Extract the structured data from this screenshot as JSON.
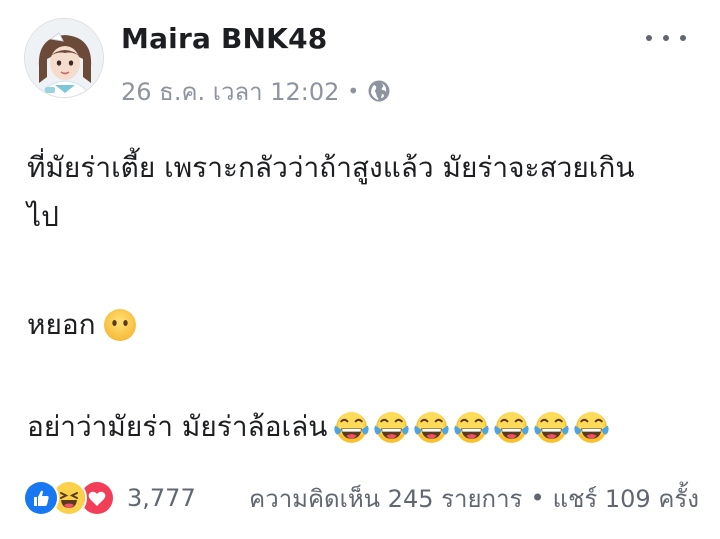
{
  "post": {
    "author": "Maira BNK48",
    "date": "26 ธ.ค. เวลา 12:02",
    "separator": "•",
    "privacy_icon": "globe-icon",
    "more_icon": "more-options-icon",
    "lines": [
      "ที่มัยร่าเตี้ย เพราะกลัวว่าถ้าสูงแล้ว มัยร่าจะสวยเกิน",
      "ไป",
      "หยอก",
      "อย่าว่ามัยร่า มัยร่าล้อเล่น"
    ],
    "line3_emoji": "neutral-face-icon",
    "line4_emoji": "joy-face-icon",
    "line4_emoji_count": 7
  },
  "footer": {
    "reactions": [
      "like-reaction-icon",
      "haha-reaction-icon",
      "love-reaction-icon"
    ],
    "reaction_count": "3,777",
    "comments": "ความคิดเห็น 245 รายการ",
    "separator": "•",
    "shares": "แชร์ 109 ครั้ง"
  },
  "colors": {
    "text": "#1c1e21",
    "meta": "#8d949e",
    "like_blue": "#1877f2",
    "love_red": "#f33e58",
    "emoji_yellow": "#fbd14b"
  }
}
